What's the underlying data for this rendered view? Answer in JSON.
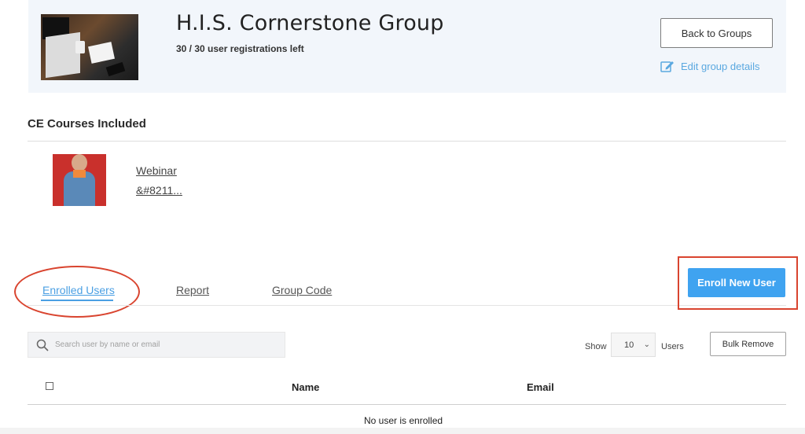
{
  "group": {
    "title": "H.I.S. Cornerstone Group",
    "registrations": "30 / 30 user registrations left",
    "back_label": "Back to Groups",
    "edit_label": "Edit group details"
  },
  "courses": {
    "section_title": "CE Courses Included",
    "items": [
      {
        "line1": "Webinar",
        "line2": "&#8211..."
      }
    ]
  },
  "tabs": {
    "enrolled": "Enrolled Users",
    "report": "Report",
    "group_code": "Group Code",
    "active": "Enrolled Users"
  },
  "actions": {
    "enroll_label": "Enroll New User",
    "bulk_remove_label": "Bulk Remove"
  },
  "search": {
    "placeholder": "Search user by name or email"
  },
  "pagination": {
    "show_label": "Show",
    "show_value": "10",
    "users_label": "Users"
  },
  "table": {
    "columns": [
      "Name",
      "Email"
    ],
    "empty_message": "No user is enrolled"
  },
  "colors": {
    "accent": "#3fa3f0",
    "annotation": "#d9442f",
    "header_bg": "#f2f6fb"
  }
}
